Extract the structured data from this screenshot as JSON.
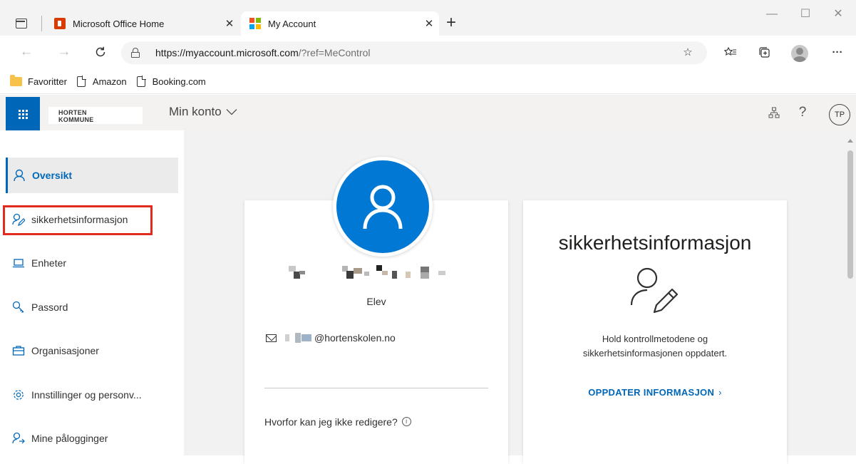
{
  "browser": {
    "tabs": [
      {
        "title": "Microsoft Office Home",
        "active": false,
        "icon": "office-icon"
      },
      {
        "title": "My Account",
        "active": true,
        "icon": "microsoft-logo-icon"
      }
    ],
    "close_glyph": "✕",
    "new_tab_glyph": "+",
    "window_controls": {
      "minimize": "—",
      "maximize": "☐",
      "close": "✕"
    },
    "address": {
      "url_host": "https://myaccount.microsoft.com",
      "url_rest": "/?ref=MeControl"
    },
    "more_glyph": "···",
    "favorites": [
      {
        "label": "Favoritter",
        "icon": "folder-icon"
      },
      {
        "label": "Amazon",
        "icon": "page-icon"
      },
      {
        "label": "Booking.com",
        "icon": "page-icon"
      }
    ],
    "colors": {
      "ms_red": "#f25022",
      "ms_green": "#7fba00",
      "ms_blue": "#00a4ef",
      "ms_yellow": "#ffb900"
    }
  },
  "header": {
    "org_logo_line1": "HORTEN",
    "org_logo_line2": "KOMMUNE",
    "app_title": "Min konto",
    "help_glyph": "?",
    "user_initials": "TP",
    "accent_color": "#0067b8"
  },
  "sidebar": {
    "items": [
      {
        "label": "Oversikt",
        "icon": "person-icon",
        "active": true
      },
      {
        "label": "sikkerhetsinformasjon",
        "icon": "security-info-icon",
        "active": false,
        "highlighted": true
      },
      {
        "label": "Enheter",
        "icon": "laptop-icon",
        "active": false
      },
      {
        "label": "Passord",
        "icon": "key-icon",
        "active": false
      },
      {
        "label": "Organisasjoner",
        "icon": "briefcase-icon",
        "active": false
      },
      {
        "label": "Innstillinger og personv...",
        "icon": "gear-icon",
        "active": false
      },
      {
        "label": "Mine pålogginger",
        "icon": "sign-ins-icon",
        "active": false
      }
    ]
  },
  "profile_card": {
    "role": "Elev",
    "email_domain": "@hortenskolen.no",
    "why_cant_edit": "Hvorfor kan jeg ikke redigere?",
    "info_glyph": "i"
  },
  "security_card": {
    "title": "sikkerhetsinformasjon",
    "description_line1": "Hold kontrollmetodene og",
    "description_line2": "sikkerhetsinformasjonen oppdatert.",
    "link_label": "OPPDATER INFORMASJON",
    "link_arrow": "›"
  }
}
